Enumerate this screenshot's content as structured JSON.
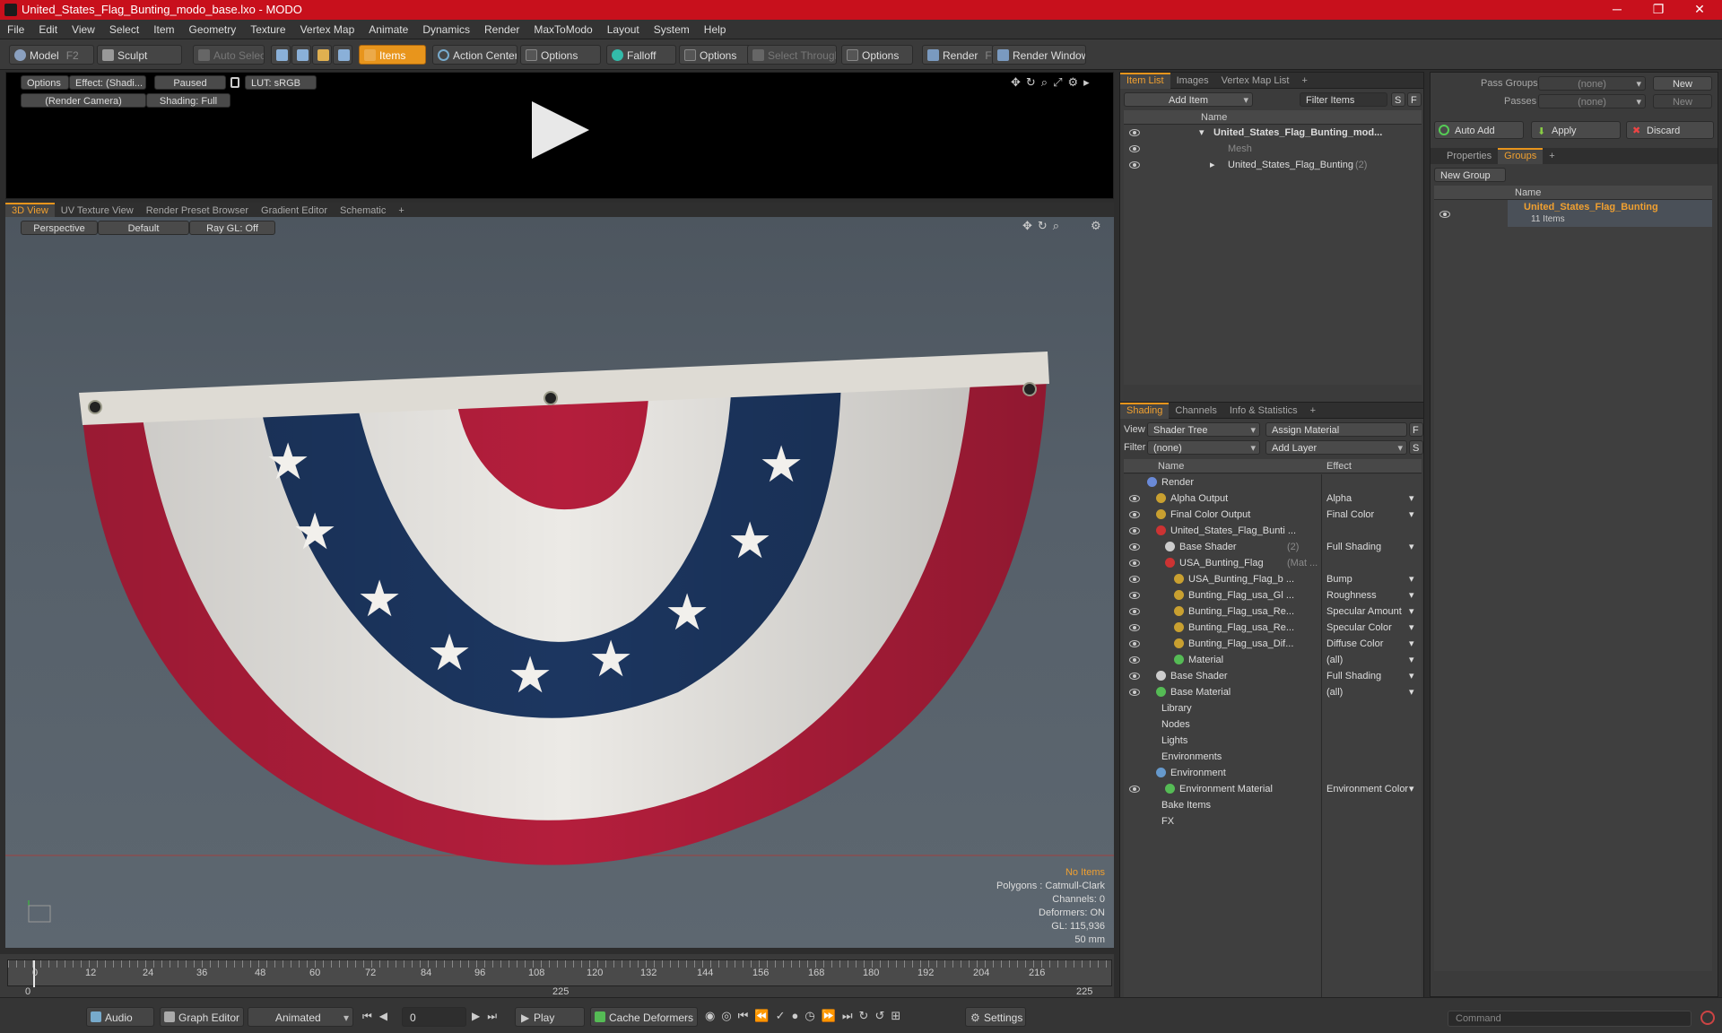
{
  "window": {
    "title": "United_States_Flag_Bunting_modo_base.lxo - MODO",
    "minimize": "─",
    "maximize": "❐",
    "close": "✕"
  },
  "menu": [
    "File",
    "Edit",
    "View",
    "Select",
    "Item",
    "Geometry",
    "Texture",
    "Vertex Map",
    "Animate",
    "Dynamics",
    "Render",
    "MaxToModo",
    "Layout",
    "System",
    "Help"
  ],
  "toolbar": {
    "model": "Model",
    "model_key": "F2",
    "sculpt": "Sculpt",
    "auto_select": "Auto Select",
    "items": "Items",
    "action_center": "Action Center",
    "options": "Options",
    "falloff": "Falloff",
    "select_through": "Select Through",
    "render": "Render",
    "render_key": "F9",
    "render_window": "Render Window"
  },
  "render_preview": {
    "options": "Options",
    "effect": "Effect: (Shadi...",
    "paused": "Paused",
    "lut": "LUT: sRGB",
    "camera": "(Render Camera)",
    "shading": "Shading: Full"
  },
  "view_tabs": [
    "3D View",
    "UV Texture View",
    "Render Preset Browser",
    "Gradient Editor",
    "Schematic",
    "+"
  ],
  "viewport": {
    "perspective": "Perspective",
    "default": "Default",
    "raygl": "Ray GL: Off",
    "stats": [
      "No Items",
      "Polygons : Catmull-Clark",
      "Channels: 0",
      "Deformers: ON",
      "GL: 115,936",
      "50 mm"
    ],
    "colors": {
      "red": "#b41e3c",
      "white": "#eceae6",
      "blue": "#1c3660",
      "header": "#dedbd4"
    }
  },
  "item_list": {
    "tabs": [
      "Item List",
      "Images",
      "Vertex Map List",
      "+"
    ],
    "add_item": "Add Item",
    "filter_items": "Filter Items",
    "s": "S",
    "f": "F",
    "col_name": "Name",
    "rows": [
      {
        "label": "United_States_Flag_Bunting_mod...",
        "count": ""
      },
      {
        "label": "Mesh",
        "count": ""
      },
      {
        "label": "United_States_Flag_Bunting",
        "count": "(2)"
      }
    ]
  },
  "shading": {
    "tabs": [
      "Shading",
      "Channels",
      "Info & Statistics",
      "+"
    ],
    "view_label": "View",
    "view_value": "Shader Tree",
    "assign_material": "Assign Material",
    "filter_label": "Filter",
    "filter_value": "(none)",
    "add_layer": "Add Layer",
    "f": "F",
    "s": "S",
    "col_name": "Name",
    "col_effect": "Effect",
    "rows": [
      {
        "name": "Render",
        "effect": "",
        "note": ""
      },
      {
        "name": "Alpha Output",
        "effect": "Alpha",
        "note": ""
      },
      {
        "name": "Final Color Output",
        "effect": "Final Color",
        "note": ""
      },
      {
        "name": "United_States_Flag_Bunti ...",
        "effect": "",
        "note": ""
      },
      {
        "name": "Base Shader",
        "effect": "Full Shading",
        "note": "(2)"
      },
      {
        "name": "USA_Bunting_Flag",
        "effect": "",
        "note": "(Mat ..."
      },
      {
        "name": "USA_Bunting_Flag_b ...",
        "effect": "Bump",
        "note": ""
      },
      {
        "name": "Bunting_Flag_usa_Gl ...",
        "effect": "Roughness",
        "note": ""
      },
      {
        "name": "Bunting_Flag_usa_Re...",
        "effect": "Specular Amount",
        "note": ""
      },
      {
        "name": "Bunting_Flag_usa_Re...",
        "effect": "Specular Color",
        "note": ""
      },
      {
        "name": "Bunting_Flag_usa_Dif...",
        "effect": "Diffuse Color",
        "note": ""
      },
      {
        "name": "Material",
        "effect": "(all)",
        "note": ""
      },
      {
        "name": "Base Shader",
        "effect": "Full Shading",
        "note": ""
      },
      {
        "name": "Base Material",
        "effect": "(all)",
        "note": ""
      },
      {
        "name": "Library",
        "effect": "",
        "note": ""
      },
      {
        "name": "Nodes",
        "effect": "",
        "note": ""
      },
      {
        "name": "Lights",
        "effect": "",
        "note": ""
      },
      {
        "name": "Environments",
        "effect": "",
        "note": ""
      },
      {
        "name": "Environment",
        "effect": "",
        "note": ""
      },
      {
        "name": "Environment Material",
        "effect": "Environment Color",
        "note": ""
      },
      {
        "name": "Bake Items",
        "effect": "",
        "note": ""
      },
      {
        "name": "FX",
        "effect": "",
        "note": ""
      }
    ]
  },
  "groups": {
    "pass_groups": "Pass Groups",
    "passes": "Passes",
    "none": "(none)",
    "new": "New",
    "auto_add": "Auto Add",
    "apply": "Apply",
    "discard": "Discard",
    "tabs": [
      "Properties",
      "Groups",
      "+"
    ],
    "new_group": "New Group",
    "col_name": "Name",
    "group_name": "United_States_Flag_Bunting",
    "group_count": "11 Items"
  },
  "timeline": {
    "ticks": [
      "0",
      "12",
      "24",
      "36",
      "48",
      "60",
      "72",
      "84",
      "96",
      "108",
      "120",
      "132",
      "144",
      "156",
      "168",
      "180",
      "192",
      "204",
      "216"
    ],
    "start": "0",
    "mid": "225",
    "end": "225"
  },
  "bottom": {
    "audio": "Audio",
    "graph_editor": "Graph Editor",
    "animated": "Animated",
    "frame": "0",
    "play": "Play",
    "cache_deformers": "Cache Deformers",
    "settings": "Settings",
    "command": "Command"
  }
}
